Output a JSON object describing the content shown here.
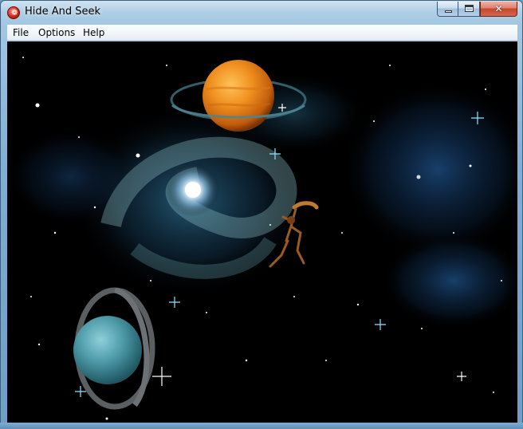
{
  "window": {
    "title": "Hide And Seek",
    "icon": "app-icon",
    "controls": [
      "minimize-icon",
      "maximize-icon",
      "close-icon"
    ]
  },
  "menubar": {
    "items": [
      "File",
      "Options",
      "Help"
    ]
  },
  "scene": {
    "description_icons": [
      "galaxy",
      "orange-ringed-planet",
      "blue-ringed-planet",
      "alien-creature",
      "stars"
    ],
    "colors": {
      "space": "#000000",
      "galaxy_core": "#ffffff",
      "nebula": "#1a4a7a",
      "orange_planet": "#e8861c",
      "blue_planet": "#4c9aa8",
      "creature": "#8a4a1a"
    }
  }
}
